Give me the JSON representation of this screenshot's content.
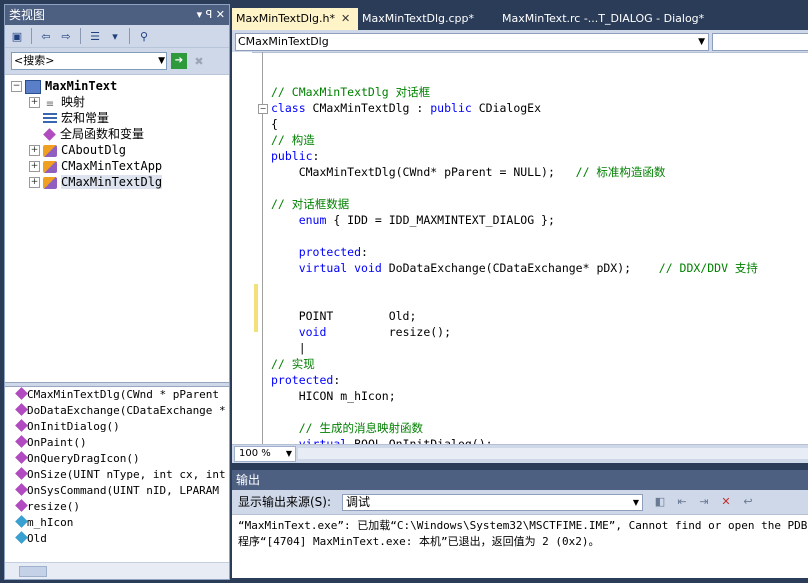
{
  "classview": {
    "title": "类视图",
    "title_controls": "▾ ꟼ ✕",
    "search_text": "<搜索>",
    "tree": [
      {
        "label": "MaxMinText",
        "bold": true,
        "expander": "⊟",
        "icon": "project-icon",
        "level": 0
      },
      {
        "label": "映射",
        "expander": "⊞",
        "icon": "map-icon",
        "level": 1
      },
      {
        "label": "宏和常量",
        "expander": "",
        "icon": "macro-icon",
        "level": 1
      },
      {
        "label": "全局函数和变量",
        "expander": "",
        "icon": "global-icon",
        "level": 1
      },
      {
        "label": "CAboutDlg",
        "expander": "⊞",
        "icon": "class-icon",
        "level": 1
      },
      {
        "label": "CMaxMinTextApp",
        "expander": "⊞",
        "icon": "class-icon",
        "level": 1
      },
      {
        "label": "CMaxMinTextDlg",
        "expander": "⊞",
        "icon": "class-icon",
        "level": 1,
        "selected": true
      }
    ],
    "members": [
      {
        "label": "CMaxMinTextDlg(CWnd * pParent",
        "kind": "method"
      },
      {
        "label": "DoDataExchange(CDataExchange *",
        "kind": "method"
      },
      {
        "label": "OnInitDialog()",
        "kind": "method"
      },
      {
        "label": "OnPaint()",
        "kind": "method"
      },
      {
        "label": "OnQueryDragIcon()",
        "kind": "method"
      },
      {
        "label": "OnSize(UINT nType, int cx, int",
        "kind": "method"
      },
      {
        "label": "OnSysCommand(UINT nID, LPARAM",
        "kind": "method"
      },
      {
        "label": "resize()",
        "kind": "method"
      },
      {
        "label": "m_hIcon",
        "kind": "field"
      },
      {
        "label": "Old",
        "kind": "field"
      }
    ]
  },
  "editor": {
    "tabs": [
      {
        "label": "MaxMinTextDlg.h*",
        "active": true,
        "close": "✕"
      },
      {
        "label": "MaxMinTextDlg.cpp*",
        "active": false
      },
      {
        "label": "MaxMinText.rc -...T_DIALOG - Dialog*",
        "active": false
      }
    ],
    "class_combo": "CMaxMinTextDlg",
    "zoom": "100 %",
    "code_lines": [
      {
        "segments": [
          {
            "t": "",
            "c": ""
          }
        ]
      },
      {
        "segments": [
          {
            "t": "// CMaxMinTextDlg 对话框",
            "c": "cm"
          }
        ]
      },
      {
        "segments": [
          {
            "t": "class",
            "c": "kw"
          },
          {
            "t": " CMaxMinTextDlg : ",
            "c": ""
          },
          {
            "t": "public",
            "c": "kw"
          },
          {
            "t": " CDialogEx",
            "c": ""
          }
        ]
      },
      {
        "segments": [
          {
            "t": "{",
            "c": ""
          }
        ]
      },
      {
        "segments": [
          {
            "t": "// 构造",
            "c": "cm"
          }
        ]
      },
      {
        "segments": [
          {
            "t": "public",
            "c": "kw"
          },
          {
            "t": ":",
            "c": ""
          }
        ]
      },
      {
        "segments": [
          {
            "t": "    CMaxMinTextDlg(CWnd* pParent = NULL);   ",
            "c": ""
          },
          {
            "t": "// 标准构造函数",
            "c": "cm"
          }
        ]
      },
      {
        "segments": [
          {
            "t": "",
            "c": ""
          }
        ]
      },
      {
        "segments": [
          {
            "t": "// 对话框数据",
            "c": "cm"
          }
        ]
      },
      {
        "segments": [
          {
            "t": "    ",
            "c": ""
          },
          {
            "t": "enum",
            "c": "kw"
          },
          {
            "t": " { IDD = IDD_MAXMINTEXT_DIALOG };",
            "c": ""
          }
        ]
      },
      {
        "segments": [
          {
            "t": "",
            "c": ""
          }
        ]
      },
      {
        "segments": [
          {
            "t": "    ",
            "c": ""
          },
          {
            "t": "protected",
            "c": "kw"
          },
          {
            "t": ":",
            "c": ""
          }
        ]
      },
      {
        "segments": [
          {
            "t": "    ",
            "c": ""
          },
          {
            "t": "virtual",
            "c": "kw"
          },
          {
            "t": " ",
            "c": ""
          },
          {
            "t": "void",
            "c": "kw"
          },
          {
            "t": " DoDataExchange(CDataExchange* pDX);    ",
            "c": ""
          },
          {
            "t": "// DDX/DDV 支持",
            "c": "cm"
          }
        ]
      },
      {
        "segments": [
          {
            "t": "",
            "c": ""
          }
        ]
      },
      {
        "segments": [
          {
            "t": "",
            "c": ""
          }
        ]
      },
      {
        "segments": [
          {
            "t": "    POINT        Old;",
            "c": ""
          }
        ]
      },
      {
        "segments": [
          {
            "t": "    ",
            "c": ""
          },
          {
            "t": "void",
            "c": "kw"
          },
          {
            "t": "         resize();",
            "c": ""
          }
        ]
      },
      {
        "segments": [
          {
            "t": "    |",
            "c": ""
          }
        ]
      },
      {
        "segments": [
          {
            "t": "// 实现",
            "c": "cm"
          }
        ]
      },
      {
        "segments": [
          {
            "t": "protected",
            "c": "kw"
          },
          {
            "t": ":",
            "c": ""
          }
        ]
      },
      {
        "segments": [
          {
            "t": "    HICON m_hIcon;",
            "c": ""
          }
        ]
      },
      {
        "segments": [
          {
            "t": "",
            "c": ""
          }
        ]
      },
      {
        "segments": [
          {
            "t": "    ",
            "c": ""
          },
          {
            "t": "// 生成的消息映射函数",
            "c": "cm"
          }
        ]
      },
      {
        "segments": [
          {
            "t": "    ",
            "c": ""
          },
          {
            "t": "virtual",
            "c": "kw"
          },
          {
            "t": " BOOL OnInitDialog();",
            "c": ""
          }
        ]
      }
    ]
  },
  "output": {
    "title": "输出",
    "source_label": "显示输出来源(S):",
    "source_value": "调试",
    "lines": [
      "“MaxMinText.exe”: 已加载“C:\\Windows\\System32\\MSCTFIME.IME”, Cannot find or open the PDB file",
      "程序“[4704] MaxMinText.exe: 本机”已退出，返回值为 2 (0x2)。"
    ]
  }
}
